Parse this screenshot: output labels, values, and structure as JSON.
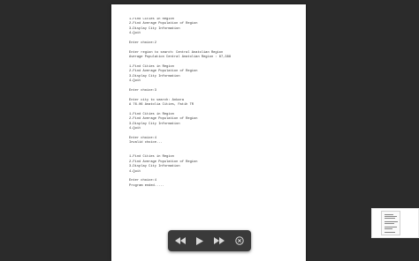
{
  "document": {
    "lines": [
      "1-Find Cities in Region",
      "2-Find Average Population of Region",
      "3-Display City Information",
      "4-Quit",
      "",
      "Enter choice:2",
      "",
      "Enter region to search: Central Anatolian Region",
      "Average Population Central Anatolian Region : 87,388",
      "",
      "1-Find Cities in Region",
      "2-Find Average Population of Region",
      "3-Display City Information",
      "4-Quit",
      "",
      "Enter choice:3",
      "",
      "Enter city to search: Ankara",
      "A 76.06 Anatolia Cities, Fatih TR",
      "",
      "1-Find Cities in Region",
      "2-Find Average Population of Region",
      "3-Display City Information",
      "4-Quit",
      "",
      "Enter choice:4",
      "Invalid choice...",
      "",
      "",
      "1-Find Cities in Region",
      "2-Find Average Population of Region",
      "3-Display City Information",
      "4-Quit",
      "",
      "Enter choice:4",
      "Program ended....."
    ]
  },
  "controls": {
    "rewind_icon": "rewind-icon",
    "play_icon": "play-icon",
    "fast_forward_icon": "fast-forward-icon",
    "close_icon": "close-circle-icon"
  },
  "colors": {
    "background": "#2b2b2b",
    "page": "#ffffff",
    "controls": "#3a3a3a",
    "icon": "#d8d8d8"
  }
}
